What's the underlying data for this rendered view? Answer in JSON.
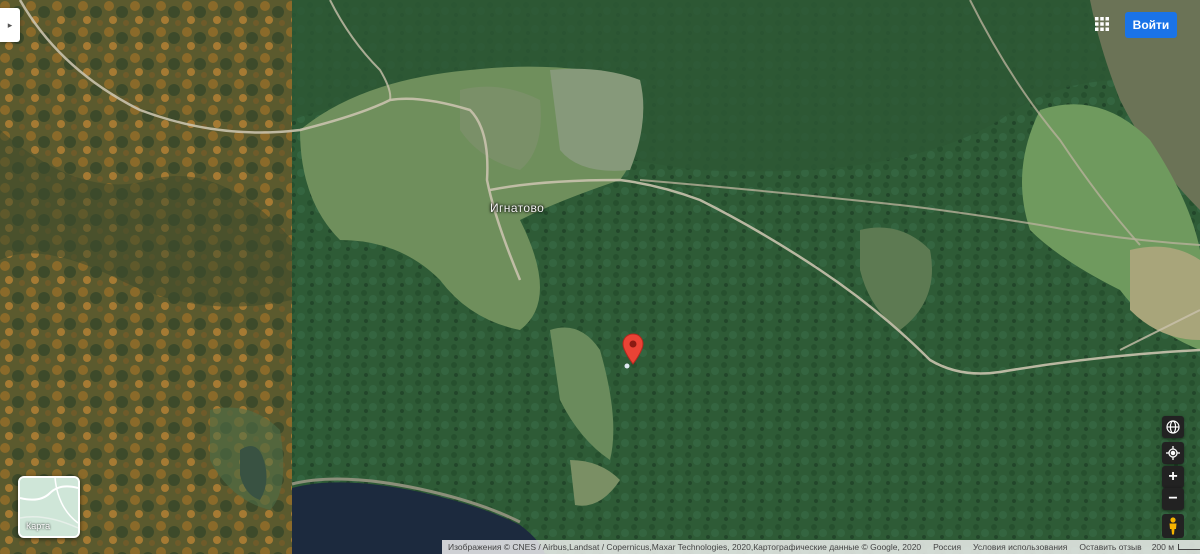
{
  "place_label": "Игнатово",
  "header": {
    "signin_label": "Войти",
    "apps_icon": "apps-grid-icon"
  },
  "side": {
    "expand_icon": "chevron-right-icon",
    "expand_glyph": "▸"
  },
  "marker": {
    "icon": "location-pin-icon",
    "color": "#ea4335"
  },
  "controls": {
    "globe_icon": "globe-icon",
    "locate_icon": "my-location-icon",
    "zoom_in": "+",
    "zoom_out": "−",
    "pegman_icon": "pegman-icon"
  },
  "minimap": {
    "label": "Карта"
  },
  "footer": {
    "attribution": "Изображения © CNES / Airbus,Landsat / Copernicus,Maxar Technologies, 2020,Картографические данные © Google, 2020",
    "region": "Россия",
    "terms": "Условия использования",
    "feedback": "Оставить отзыв",
    "scale_label": "200 м"
  },
  "colors": {
    "accent": "#1a73e8",
    "forest": "#2f5a34",
    "water": "#1c2a3e"
  }
}
